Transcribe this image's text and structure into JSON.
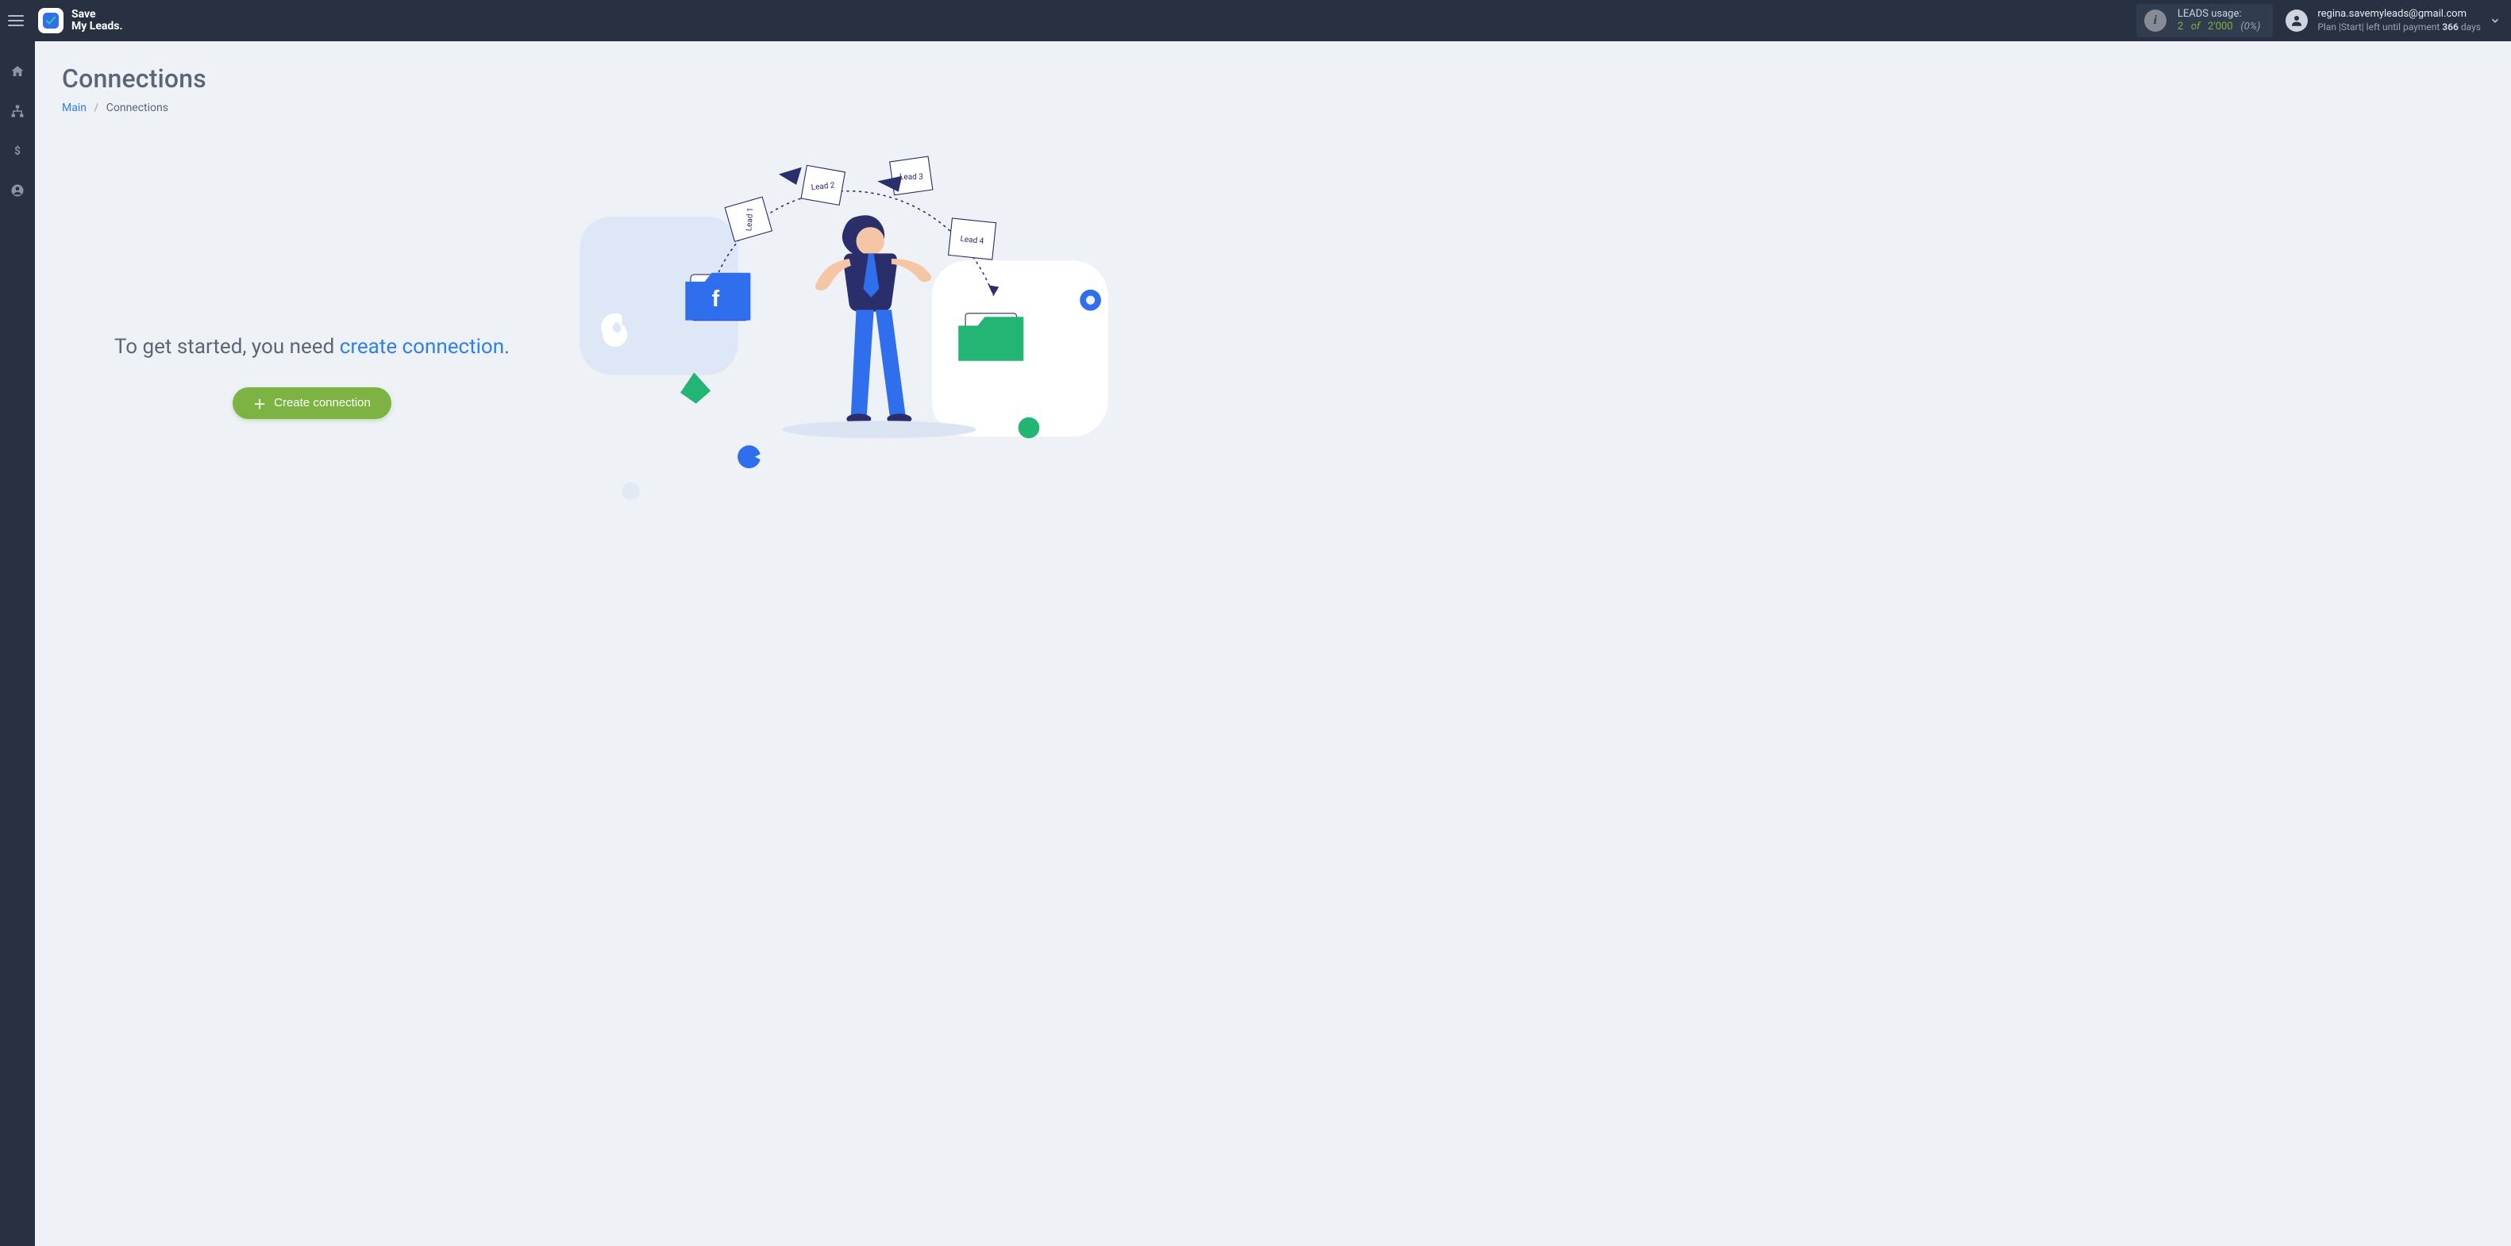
{
  "brand": {
    "line1": "Save",
    "line2": "My Leads."
  },
  "leads": {
    "title": "LEADS usage:",
    "used": "2",
    "of_word": "of",
    "total": "2'000",
    "pct": "(0%)"
  },
  "user": {
    "email": "regina.savemyleads@gmail.com",
    "plan_prefix": "Plan |Start| left until payment ",
    "days_number": "366",
    "days_word": " days"
  },
  "page": {
    "title": "Connections",
    "breadcrumb_main": "Main",
    "breadcrumb_current": "Connections"
  },
  "empty": {
    "lead_in": "To get started, you need ",
    "link_text": "create connection",
    "period": ".",
    "button": "Create connection"
  },
  "illus_notes": {
    "n1": "Lead 1",
    "n2": "Lead 2",
    "n3": "Lead 3",
    "n4": "Lead 4"
  }
}
